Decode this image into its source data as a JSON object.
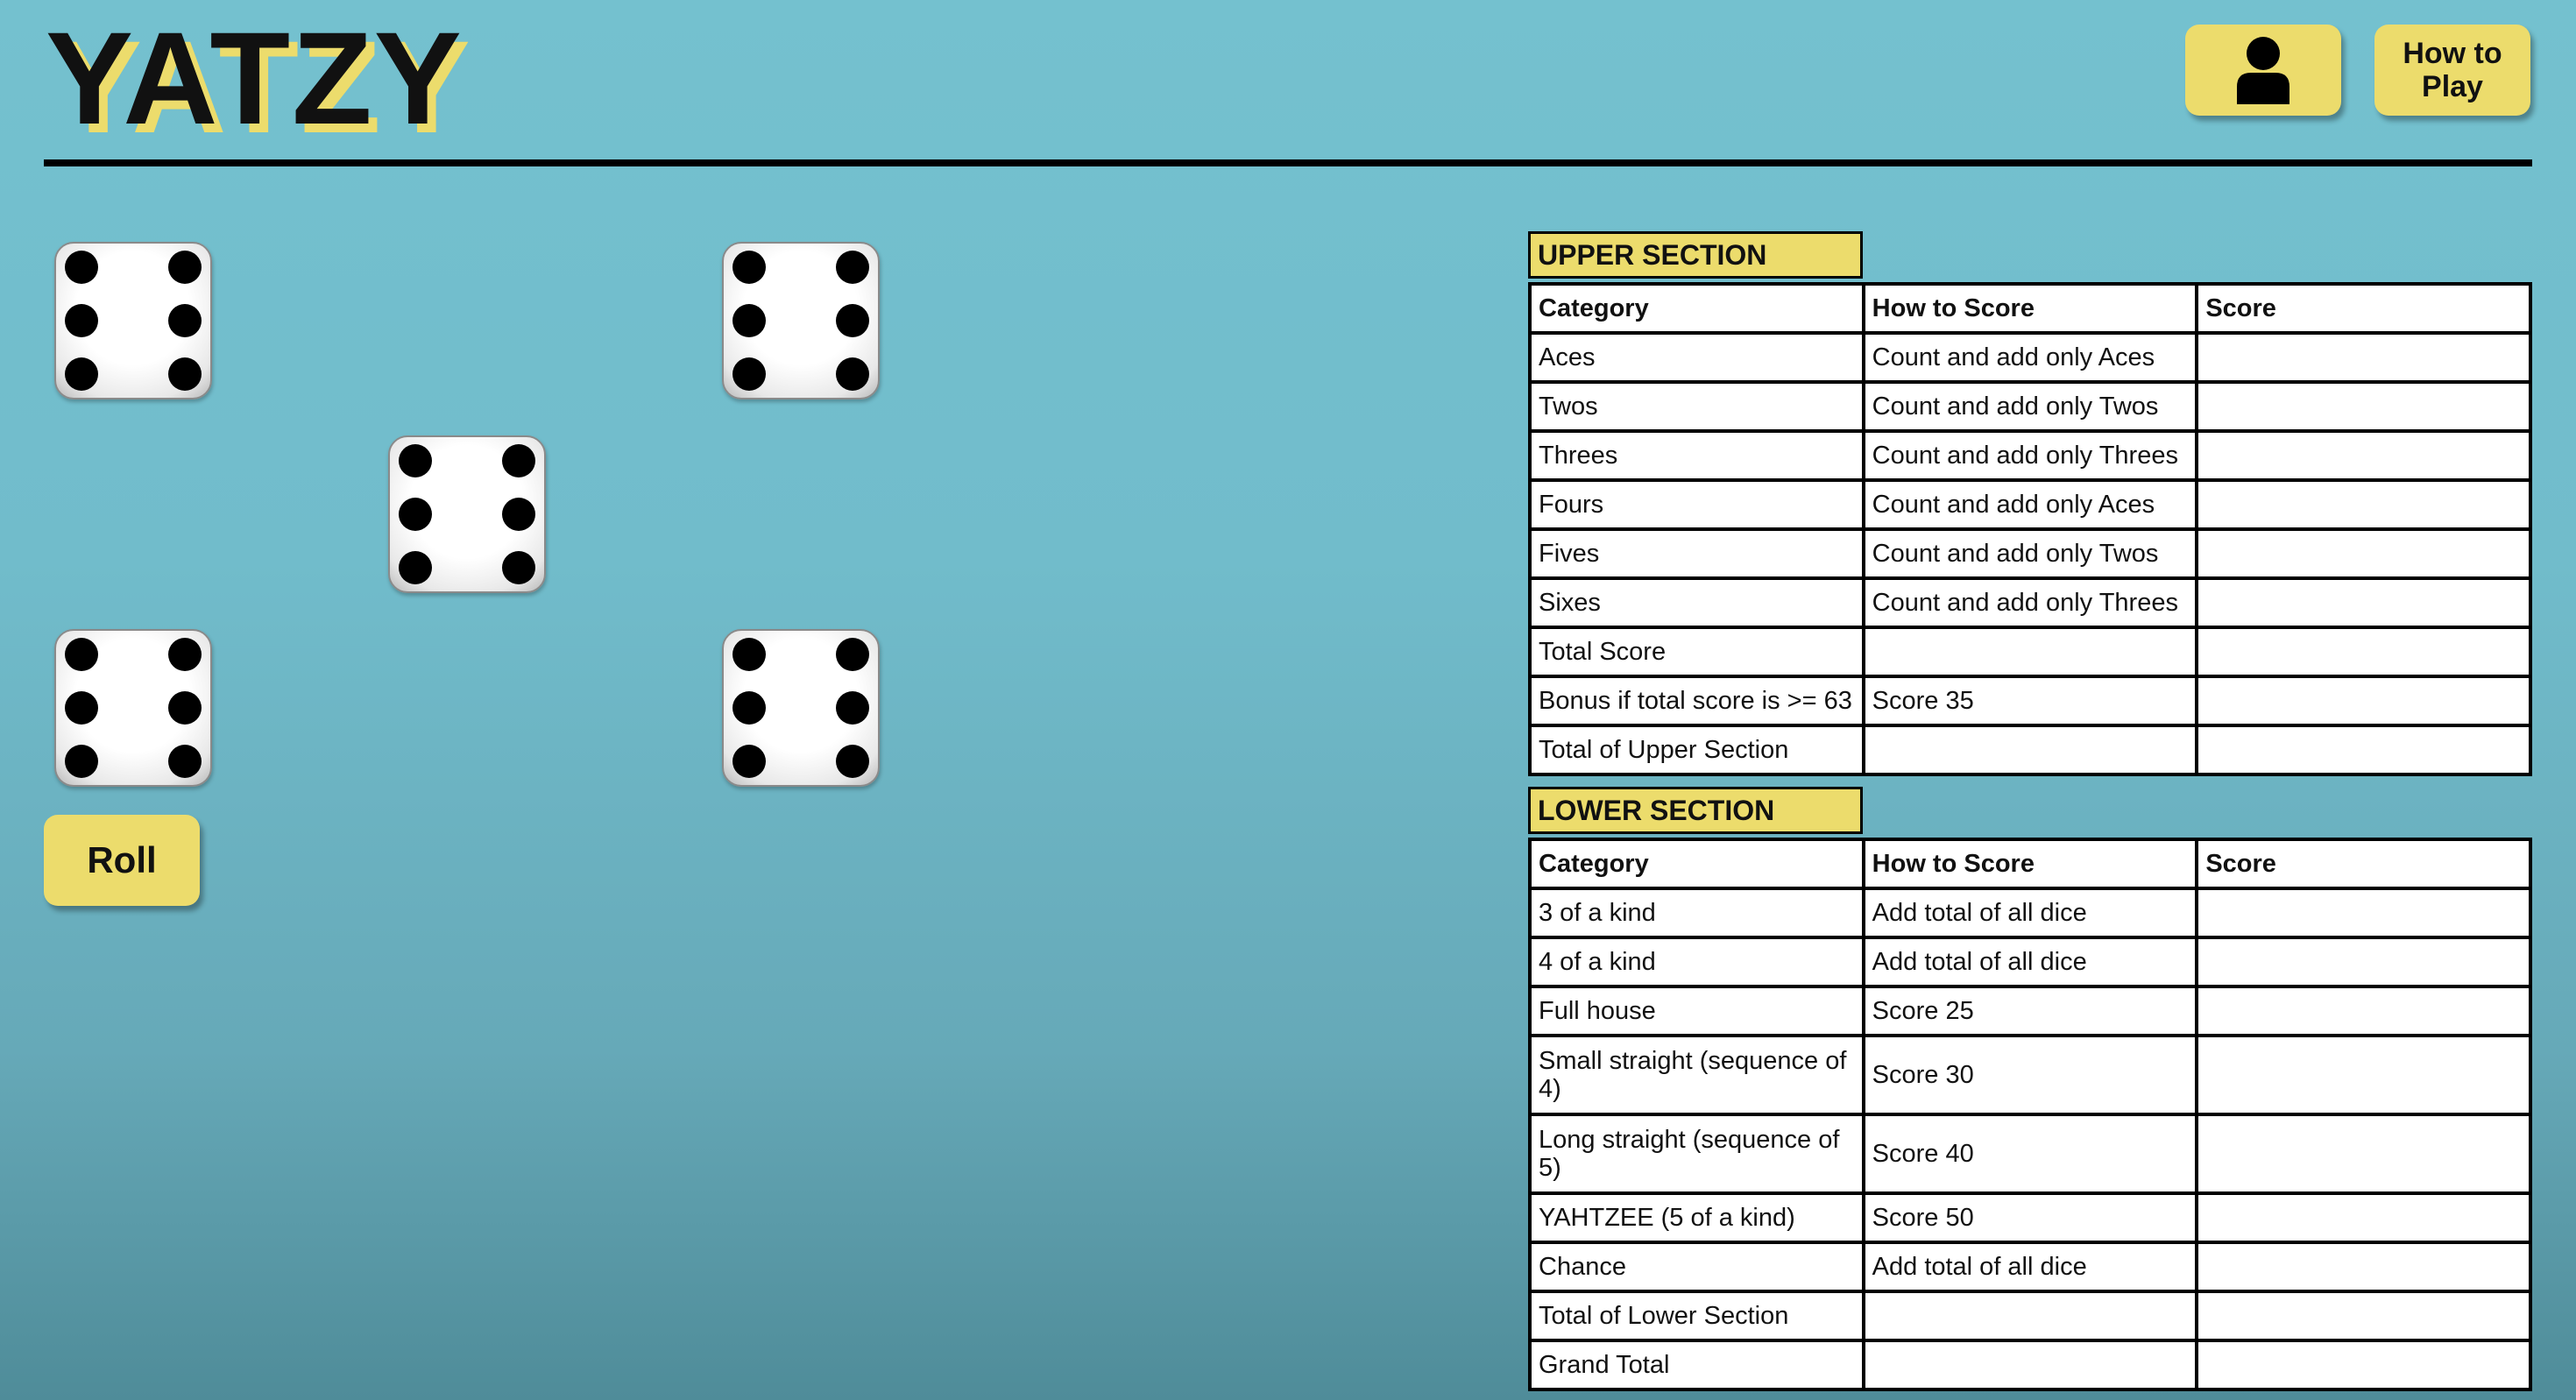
{
  "app": {
    "title": "YATZY"
  },
  "header": {
    "profile_icon": "user-icon",
    "how_to_play_label": "How to\nPlay"
  },
  "dice": [
    {
      "value": 6
    },
    {
      "value": 6
    },
    {
      "value": 6
    },
    {
      "value": 6
    },
    {
      "value": 6
    }
  ],
  "roll_label": "Roll",
  "colors": {
    "background": "#74c1cf",
    "accent_yellow": "#ecdc6c",
    "text": "#111111"
  },
  "upper_section": {
    "title": "UPPER SECTION",
    "columns": [
      "Category",
      "How to Score",
      "Score"
    ],
    "rows": [
      {
        "category": "Aces",
        "how": "Count and add only Aces",
        "score": ""
      },
      {
        "category": "Twos",
        "how": "Count and add only Twos",
        "score": ""
      },
      {
        "category": "Threes",
        "how": "Count and add only Threes",
        "score": ""
      },
      {
        "category": "Fours",
        "how": "Count and add only Aces",
        "score": ""
      },
      {
        "category": "Fives",
        "how": "Count and add only Twos",
        "score": ""
      },
      {
        "category": "Sixes",
        "how": "Count and add only Threes",
        "score": ""
      },
      {
        "category": "Total Score",
        "how": "",
        "score": ""
      },
      {
        "category": "Bonus if total score is >= 63",
        "how": "Score 35",
        "score": ""
      },
      {
        "category": "Total of Upper Section",
        "how": "",
        "score": ""
      }
    ]
  },
  "lower_section": {
    "title": "LOWER SECTION",
    "columns": [
      "Category",
      "How to Score",
      "Score"
    ],
    "rows": [
      {
        "category": "3 of a kind",
        "how": "Add total of all dice",
        "score": ""
      },
      {
        "category": "4 of a kind",
        "how": "Add total of all dice",
        "score": ""
      },
      {
        "category": "Full house",
        "how": "Score 25",
        "score": ""
      },
      {
        "category": "Small straight (sequence of 4)",
        "how": "Score 30",
        "score": ""
      },
      {
        "category": "Long straight (sequence of 5)",
        "how": "Score 40",
        "score": ""
      },
      {
        "category": "YAHTZEE (5 of a kind)",
        "how": "Score 50",
        "score": ""
      },
      {
        "category": "Chance",
        "how": "Add total of all dice",
        "score": ""
      },
      {
        "category": "Total of Lower Section",
        "how": "",
        "score": ""
      },
      {
        "category": "Grand Total",
        "how": "",
        "score": ""
      }
    ]
  }
}
